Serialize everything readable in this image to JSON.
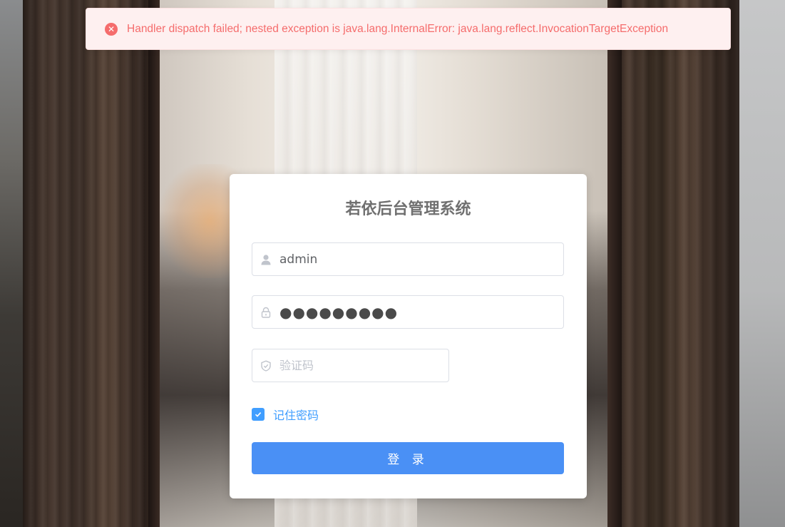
{
  "message": {
    "type": "error",
    "icon": "error-circle-icon",
    "text": "Handler dispatch failed; nested exception is java.lang.InternalError: java.lang.reflect.InvocationTargetException",
    "color": "#f56c6c",
    "background": "#fef0f0"
  },
  "login": {
    "title": "若依后台管理系统",
    "username": {
      "value": "admin",
      "icon": "user-icon"
    },
    "password": {
      "value": "●●●●●●●●●",
      "icon": "lock-icon"
    },
    "captcha": {
      "value": "",
      "placeholder": "验证码",
      "icon": "shield-icon"
    },
    "remember": {
      "label": "记住密码",
      "checked": true
    },
    "submit_label": "登 录",
    "accent_color": "#409eff"
  }
}
